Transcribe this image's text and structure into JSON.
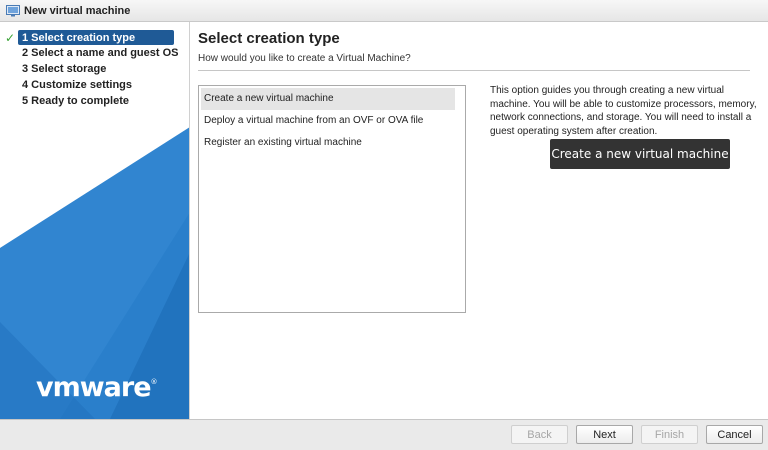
{
  "window": {
    "title": "New virtual machine",
    "icon": "vm-wizard-icon"
  },
  "sidebar": {
    "steps": [
      {
        "label": "1 Select creation type",
        "active": true,
        "completed": true
      },
      {
        "label": "2 Select a name and guest OS",
        "active": false
      },
      {
        "label": "3 Select storage",
        "active": false
      },
      {
        "label": "4 Customize settings",
        "active": false
      },
      {
        "label": "5 Ready to complete",
        "active": false
      }
    ],
    "logo": {
      "text": "vmware",
      "mark": "®"
    },
    "colors": {
      "accent": "#1f5a96",
      "panel": "#2a7fcb"
    }
  },
  "main": {
    "title": "Select creation type",
    "subtitle": "How would you like to create a Virtual Machine?",
    "options": [
      {
        "label": "Create a new virtual machine",
        "selected": true
      },
      {
        "label": "Deploy a virtual machine from an OVF or OVA file",
        "selected": false
      },
      {
        "label": "Register an existing virtual machine",
        "selected": false
      }
    ],
    "description": "This option guides you through creating a new virtual machine. You will be able to customize processors, memory, network connections, and storage. You will need to install a guest operating system after creation.",
    "tooltip": "Create a new virtual machine"
  },
  "footer": {
    "back": "Back",
    "next": "Next",
    "finish": "Finish",
    "cancel": "Cancel"
  }
}
